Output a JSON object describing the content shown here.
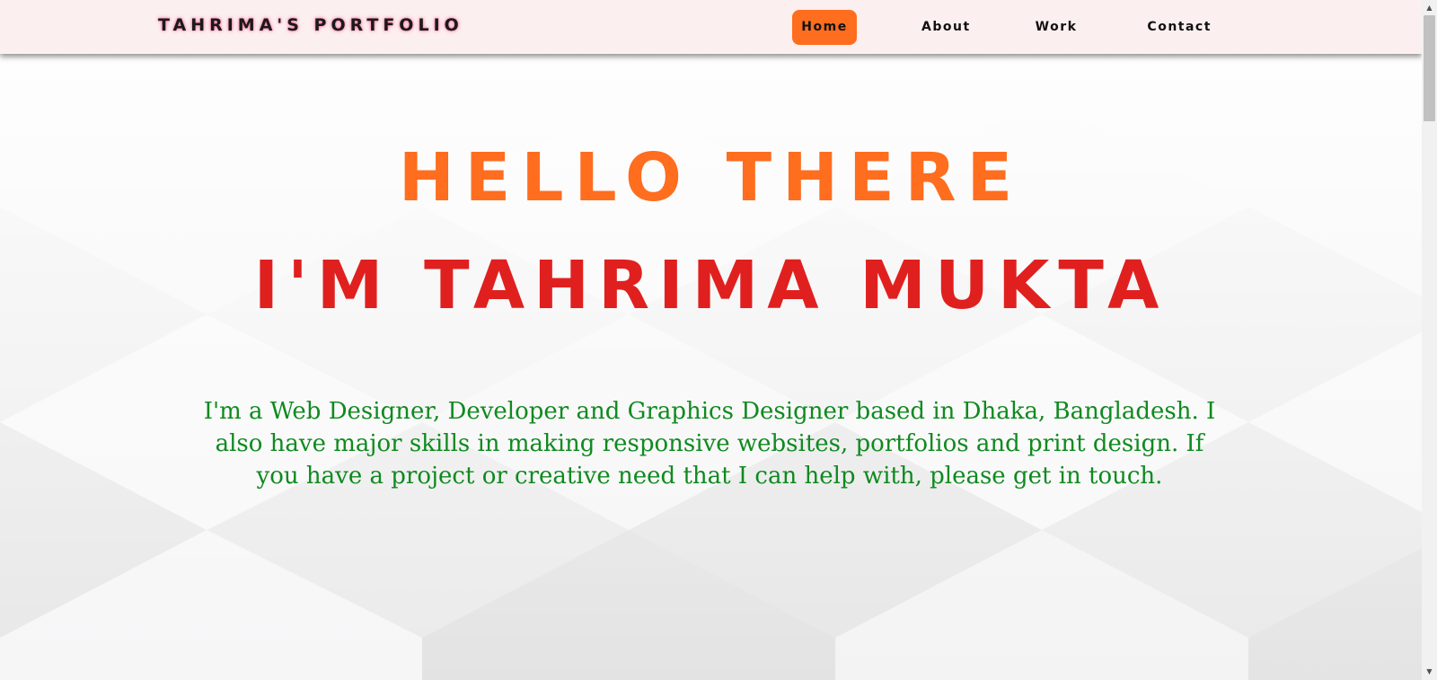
{
  "navbar": {
    "brand": "TAHRIMA'S PORTFOLIO",
    "links": [
      {
        "label": "Home",
        "active": true
      },
      {
        "label": "About",
        "active": false
      },
      {
        "label": "Work",
        "active": false
      },
      {
        "label": "Contact",
        "active": false
      }
    ]
  },
  "hero": {
    "greeting": "HELLO THERE",
    "name_line": "I'M TAHRIMA MUKTA",
    "description": "I'm a Web Designer, Developer and Graphics Designer based in Dhaka, Bangladesh. I also have major skills in making responsive websites, portfolios and print design. If you have a project or creative need that I can help with, please get in touch."
  },
  "colors": {
    "accent_orange": "#ff6d1f",
    "name_red": "#e0201f",
    "text_green": "#0f8a1f",
    "navbar_bg": "#fcefef"
  },
  "icons": {
    "scroll_up": "scroll-up-arrow-icon",
    "scroll_down": "scroll-down-arrow-icon"
  }
}
